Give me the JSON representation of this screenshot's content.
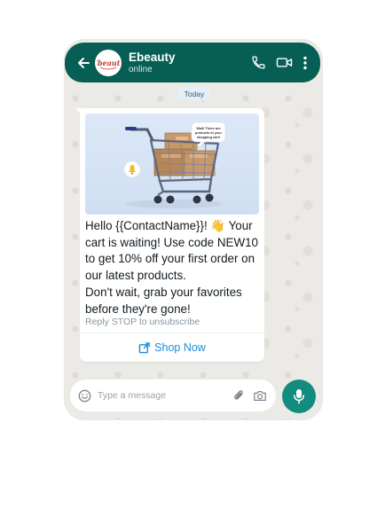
{
  "header": {
    "contact_name": "Ebeauty",
    "status": "online",
    "avatar_text": "Ebeauty"
  },
  "conversation": {
    "date_label": "Today"
  },
  "message": {
    "image_note": "Wait! There are products in your shopping cart!",
    "lines": [
      "Hello {{ContactName}}! 👋 Your cart is waiting! Use code NEW10 to get 10% off your first order on our latest products.",
      "Don't wait, grab your favorites before they're gone!"
    ],
    "footer": "Reply STOP to unsubscribe",
    "cta_label": "Shop Now"
  },
  "composer": {
    "placeholder": "Type a message"
  },
  "colors": {
    "header": "#075e54",
    "mic_button": "#128c7e",
    "link": "#1a8fd8"
  },
  "icons": {
    "back": "back-arrow-icon",
    "call": "phone-icon",
    "video": "video-camera-icon",
    "menu": "more-vertical-icon",
    "emoji": "emoji-icon",
    "attach": "paperclip-icon",
    "camera": "camera-icon",
    "mic": "microphone-icon",
    "link": "external-link-icon",
    "notification": "bell-icon"
  }
}
